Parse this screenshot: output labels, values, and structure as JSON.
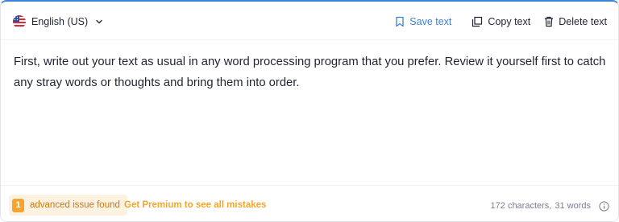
{
  "header": {
    "language": {
      "label": "English (US)",
      "flag_icon": "us-flag-icon",
      "dropdown_icon": "chevron-down-icon"
    },
    "actions": {
      "save": {
        "label": "Save text",
        "icon": "bookmark-icon",
        "color": "#3b82d6"
      },
      "copy": {
        "label": "Copy text",
        "icon": "copy-icon"
      },
      "delete": {
        "label": "Delete text",
        "icon": "trash-icon"
      }
    }
  },
  "editor": {
    "text": "First, write out your text as usual in any word processing program that you prefer. Review it yourself first to catch any stray words or thoughts and bring them into order."
  },
  "footer": {
    "issue": {
      "count": "1",
      "label": "advanced issue found",
      "color": "#f3a530"
    },
    "premium_link": "Get Premium to see all mistakes",
    "stats": {
      "characters": "172 characters,",
      "words": "31 words"
    },
    "info_icon": "info-icon"
  },
  "colors": {
    "accent": "#3b82d6",
    "warning": "#f3a530",
    "warning_bg": "#fdf1e0",
    "text": "#1f2430",
    "muted": "#7b8090"
  }
}
